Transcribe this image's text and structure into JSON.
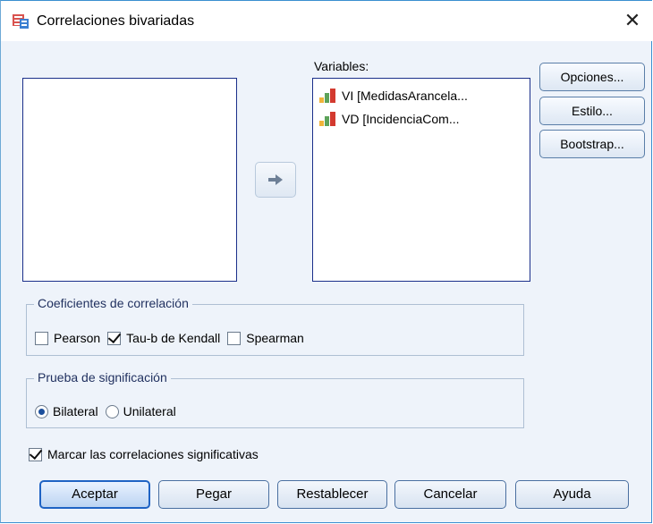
{
  "window": {
    "title": "Correlaciones bivariadas",
    "close_glyph": "✕",
    "icon": "spss-dialog-icon"
  },
  "source_list": {
    "items": []
  },
  "move_button": {
    "icon": "arrow-right-icon"
  },
  "variables": {
    "label": "Variables:",
    "items": [
      {
        "label": "VI [MedidasArancela...",
        "icon": "ordinal-measure-icon"
      },
      {
        "label": "VD [IncidenciaCom...",
        "icon": "ordinal-measure-icon"
      }
    ]
  },
  "side_buttons": {
    "options": "Opciones...",
    "style": "Estilo...",
    "bootstrap": "Bootstrap..."
  },
  "coefficients": {
    "legend": "Coeficientes de correlación",
    "pearson": {
      "label": "Pearson",
      "checked": false
    },
    "kendall": {
      "label": "Tau-b de Kendall",
      "checked": true
    },
    "spearman": {
      "label": "Spearman",
      "checked": false
    }
  },
  "significance": {
    "legend": "Prueba de significación",
    "bilateral": {
      "label": "Bilateral",
      "selected": true
    },
    "unilateral": {
      "label": "Unilateral",
      "selected": false
    }
  },
  "flag_significant": {
    "label": "Marcar las correlaciones significativas",
    "checked": true
  },
  "footer": {
    "ok": "Aceptar",
    "paste": "Pegar",
    "reset": "Restablecer",
    "cancel": "Cancelar",
    "help": "Ayuda"
  },
  "colors": {
    "frame": "#3a8fd0",
    "dialog_bg": "#eef3fa",
    "list_border": "#1a2f8a",
    "default_button": "#1f63c4"
  }
}
